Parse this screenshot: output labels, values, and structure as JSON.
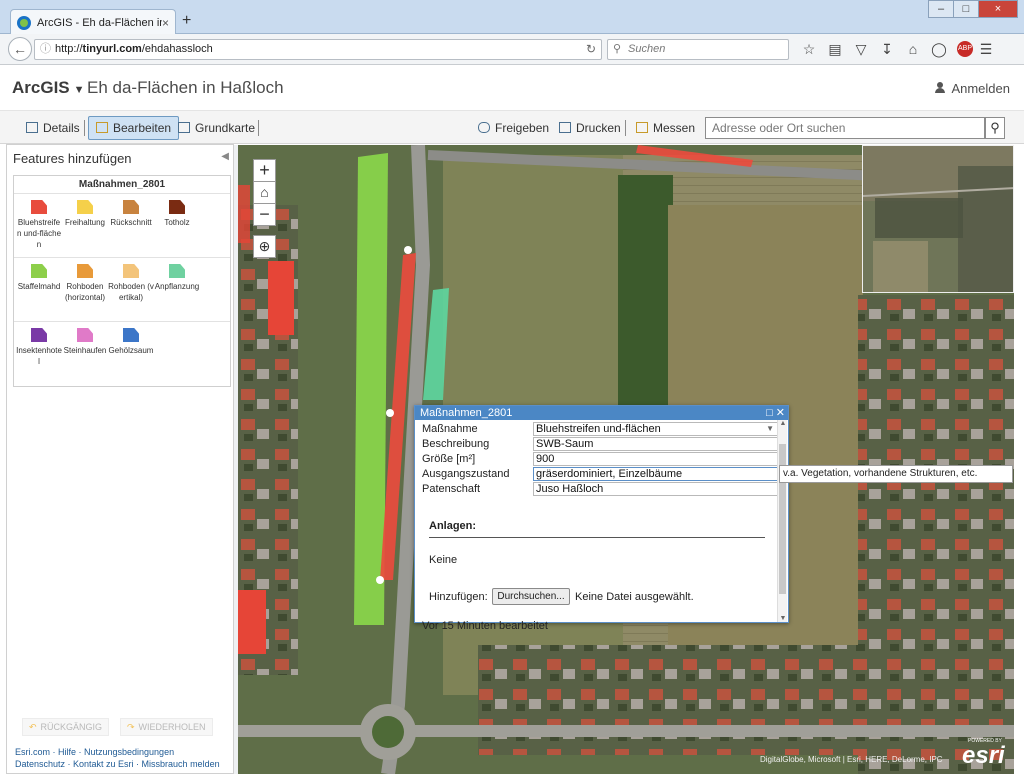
{
  "browser": {
    "tab_title": "ArcGIS - Eh da-Flächen in ...",
    "tab_close": "×",
    "new_tab": "+",
    "url_prefix": "http://",
    "url_host": "tinyurl.com",
    "url_path": "/ehdahassloch",
    "search_placeholder": "Suchen",
    "window_buttons": [
      "–",
      "□",
      "×"
    ]
  },
  "app": {
    "brand": "ArcGIS",
    "title": "Eh da-Flächen in Haßloch",
    "signin": "Anmelden"
  },
  "toolbar": {
    "details": "Details",
    "edit": "Bearbeiten",
    "basemap": "Grundkarte",
    "share": "Freigeben",
    "print": "Drucken",
    "measure": "Messen",
    "search_placeholder": "Adresse oder Ort suchen"
  },
  "panel": {
    "title": "Features hinzufügen",
    "layer_name": "Maßnahmen_2801",
    "templates": [
      {
        "label": "Bluehstreifen und-flächen",
        "color": "#e84c3d"
      },
      {
        "label": "Freihaltung",
        "color": "#f5d04a"
      },
      {
        "label": "Rückschnitt",
        "color": "#c8833f"
      },
      {
        "label": "Totholz",
        "color": "#7a2b12"
      },
      {
        "label": "Staffelmahd",
        "color": "#8dcf4a"
      },
      {
        "label": "Rohboden (horizontal)",
        "color": "#e89a3a"
      },
      {
        "label": "Rohboden (vertikal)",
        "color": "#f3c47a"
      },
      {
        "label": "Anpflanzung",
        "color": "#6fd1a0"
      },
      {
        "label": "Insektenhotel",
        "color": "#7a3aa6"
      },
      {
        "label": "Steinhaufen",
        "color": "#e07ac8"
      },
      {
        "label": "Gehölzsaum",
        "color": "#3c76c8"
      }
    ],
    "undo": "RÜCKGÄNGIG",
    "redo": "WIEDERHOLEN",
    "footer_line1": "Esri.com · Hilfe · Nutzungsbedingungen",
    "footer_line2": "Datenschutz · Kontakt zu Esri · Missbrauch melden"
  },
  "popup": {
    "title": "Maßnahmen_2801",
    "fields": [
      {
        "label": "Maßnahme",
        "value": "Bluehstreifen und-flächen"
      },
      {
        "label": "Beschreibung",
        "value": "SWB-Saum"
      },
      {
        "label": "Größe [m²]",
        "value": "900"
      },
      {
        "label": "Ausgangszustand",
        "value": "gräserdominiert, Einzelbäume"
      },
      {
        "label": "Patenschaft",
        "value": "Juso Haßloch"
      }
    ],
    "attachments_label": "Anlagen:",
    "no_attachments": "Keine",
    "add_label": "Hinzufügen:",
    "browse_button": "Durchsuchen...",
    "no_file": "Keine Datei ausgewählt.",
    "edited": "Vor 15 Minuten bearbeitet",
    "tooltip": "v.a. Vegetation, vorhandene Strukturen, etc."
  },
  "map": {
    "attribution": "DigitalGlobe, Microsoft | Esri, HERE, DeLorme, IPC",
    "esri_logo": "esri",
    "esri_powered": "POWERED BY"
  }
}
